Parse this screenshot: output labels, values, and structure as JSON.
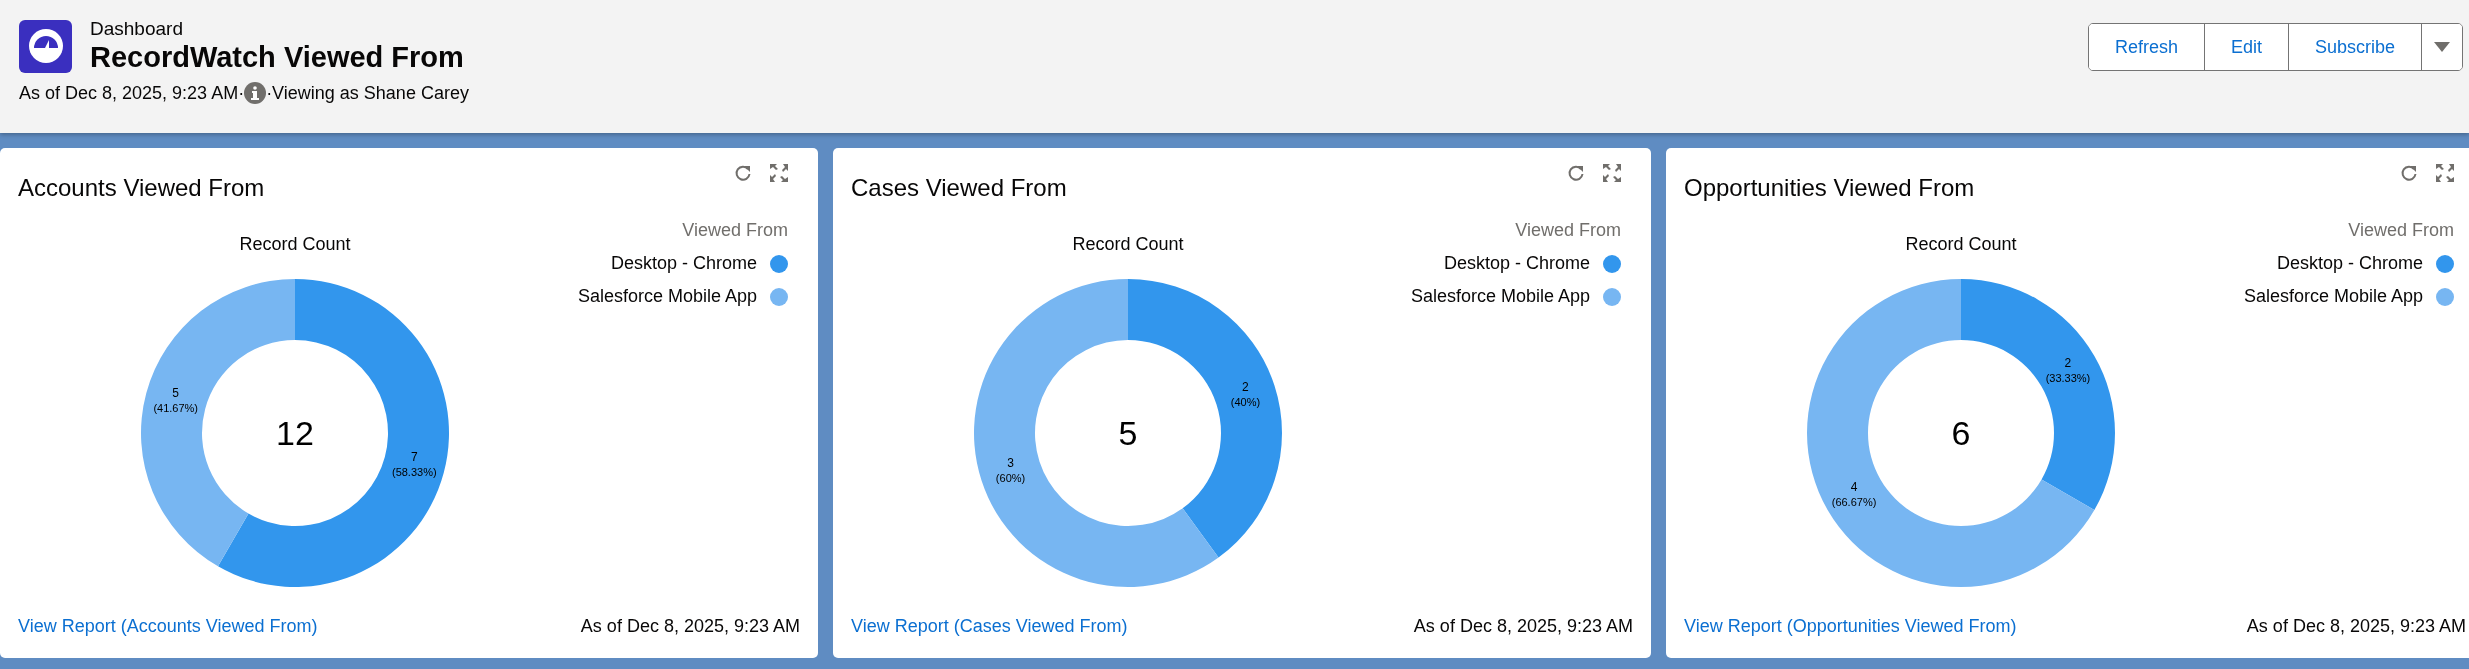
{
  "header": {
    "object_type": "Dashboard",
    "title": "RecordWatch Viewed From",
    "as_of": "As of Dec 8, 2025, 9:23 AM·",
    "viewing_as": "·Viewing as Shane Carey",
    "buttons": [
      "Refresh",
      "Edit",
      "Subscribe"
    ]
  },
  "cards": [
    {
      "title": "Accounts Viewed From",
      "chart_data": {
        "type": "donut",
        "title": "Record Count",
        "values": [
          7,
          5
        ],
        "data_labels": true
      },
      "total": "12",
      "slice_labels": [
        {
          "count": "7",
          "share": "(58.33%)"
        },
        {
          "count": "5",
          "share": "(41.67%)"
        }
      ],
      "legend": {
        "title": "Viewed From",
        "items": [
          {
            "label": "Desktop - Chrome",
            "color": "#3296ed"
          },
          {
            "label": "Salesforce Mobile App",
            "color": "#77b6f2"
          }
        ]
      },
      "link": "View Report (Accounts Viewed From)",
      "as_of": "As of Dec 8, 2025, 9:23 AM"
    },
    {
      "title": "Cases Viewed From",
      "chart_data": {
        "type": "donut",
        "title": "Record Count",
        "values": [
          2,
          3
        ],
        "data_labels": true
      },
      "total": "5",
      "slice_labels": [
        {
          "count": "2",
          "share": "(40%)"
        },
        {
          "count": "3",
          "share": "(60%)"
        }
      ],
      "legend": {
        "title": "Viewed From",
        "items": [
          {
            "label": "Desktop - Chrome",
            "color": "#3296ed"
          },
          {
            "label": "Salesforce Mobile App",
            "color": "#77b6f2"
          }
        ]
      },
      "link": "View Report (Cases Viewed From)",
      "as_of": "As of Dec 8, 2025, 9:23 AM"
    },
    {
      "title": "Opportunities Viewed From",
      "chart_data": {
        "type": "donut",
        "title": "Record Count",
        "values": [
          2,
          4
        ],
        "data_labels": true
      },
      "total": "6",
      "slice_labels": [
        {
          "count": "2",
          "share": "(33.33%)"
        },
        {
          "count": "4",
          "share": "(66.67%)"
        }
      ],
      "legend": {
        "title": "Viewed From",
        "items": [
          {
            "label": "Desktop - Chrome",
            "color": "#3296ed"
          },
          {
            "label": "Salesforce Mobile App",
            "color": "#77b6f2"
          }
        ]
      },
      "link": "View Report (Opportunities Viewed From)",
      "as_of": "As of Dec 8, 2025, 9:23 AM"
    }
  ]
}
